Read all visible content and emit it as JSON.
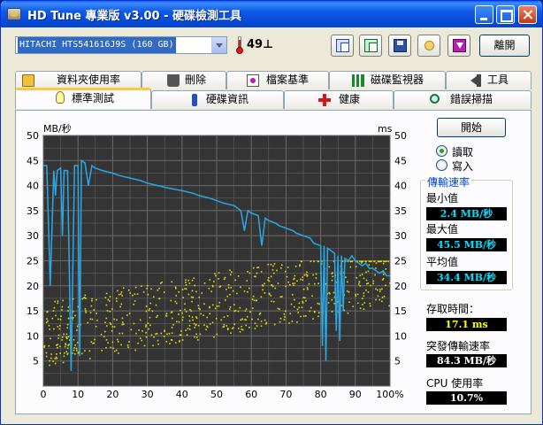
{
  "window": {
    "title": "HD Tune 專業版 v3.00 - 硬碟檢測工具",
    "controls": [
      "minimize",
      "maximize",
      "close"
    ]
  },
  "toolbar": {
    "drive": "HITACHI HTS541616J9S  (160 GB)",
    "temperature": "49",
    "temperature_unit": "⊥",
    "icons": [
      "copy-text-icon",
      "copy-screenshot-icon",
      "save-icon",
      "options-icon",
      "download-icon"
    ],
    "exit_label": "離開"
  },
  "tabs_row1": [
    "資料夾使用率",
    "刪除",
    "檔案基準",
    "磁碟監視器",
    "工具"
  ],
  "tabs_row2": [
    "標準測試",
    "硬碟資訊",
    "健康",
    "錯誤掃描"
  ],
  "active_tab": "標準測試",
  "controls": {
    "start_label": "開始",
    "radio_read": "讀取",
    "radio_write": "寫入",
    "selected_mode": "讀取"
  },
  "stats": {
    "transfer_title": "傳輸速率",
    "min_label": "最小值",
    "min_value": "2.4 MB/秒",
    "max_label": "最大值",
    "max_value": "45.5 MB/秒",
    "avg_label": "平均值",
    "avg_value": "34.4 MB/秒",
    "access_label": "存取時間：",
    "access_value": "17.1 ms",
    "burst_label": "突發傳輸速率",
    "burst_value": "84.3 MB/秒",
    "cpu_label": "CPU 使用率",
    "cpu_value": "10.7%"
  },
  "chart_data": {
    "type": "line",
    "ylabel_left": "MB/秒",
    "ylabel_right": "ms",
    "ylim": [
      0,
      50
    ],
    "yticks": [
      5,
      10,
      15,
      20,
      25,
      30,
      35,
      40,
      45,
      50
    ],
    "xlim": [
      0,
      100
    ],
    "xticks": [
      "0",
      "10",
      "20",
      "30",
      "40",
      "50",
      "60",
      "70",
      "80",
      "90",
      "100%"
    ],
    "grid": true,
    "series": [
      {
        "name": "transfer_rate",
        "color": "#2aa8e6",
        "x": [
          0,
          1,
          2,
          3,
          3.5,
          4,
          5,
          5.5,
          6,
          7,
          8,
          9,
          10,
          10.5,
          11,
          12,
          13,
          14,
          15,
          17,
          20,
          22,
          25,
          28,
          30,
          33,
          36,
          40,
          43,
          45,
          48,
          50,
          52,
          55,
          57,
          58,
          59,
          60,
          62,
          63,
          64,
          65,
          67,
          68,
          70,
          72,
          73,
          75,
          77,
          78,
          80,
          80.5,
          81,
          81.5,
          82,
          83,
          84,
          84.5,
          85,
          85.5,
          86,
          86.5,
          87,
          88,
          89,
          90,
          91,
          92,
          93,
          94,
          95,
          96,
          97,
          98,
          99,
          100
        ],
        "y": [
          44,
          44,
          20,
          43,
          38,
          43,
          43.5,
          30,
          43,
          43,
          3,
          44,
          44,
          6,
          45,
          44.5,
          40,
          44,
          43.5,
          43,
          42.5,
          42,
          41.5,
          41,
          40.5,
          40,
          39.5,
          39,
          38.5,
          38,
          37.5,
          37,
          36.5,
          36,
          35,
          31,
          35,
          34.5,
          34,
          28,
          33.5,
          33,
          32.5,
          32,
          31.5,
          31,
          30.5,
          30,
          29.5,
          28.5,
          28,
          8,
          28,
          5,
          27.5,
          27,
          26.5,
          11,
          26,
          9,
          26,
          15,
          25.5,
          25,
          26,
          25,
          24.5,
          24,
          24.5,
          23.5,
          23.5,
          23,
          22.5,
          23,
          22,
          22
        ]
      },
      {
        "name": "access_time",
        "color": "#e0e000",
        "type": "scatter",
        "x_range": [
          0,
          100
        ],
        "y_range": [
          2,
          25
        ]
      }
    ]
  }
}
